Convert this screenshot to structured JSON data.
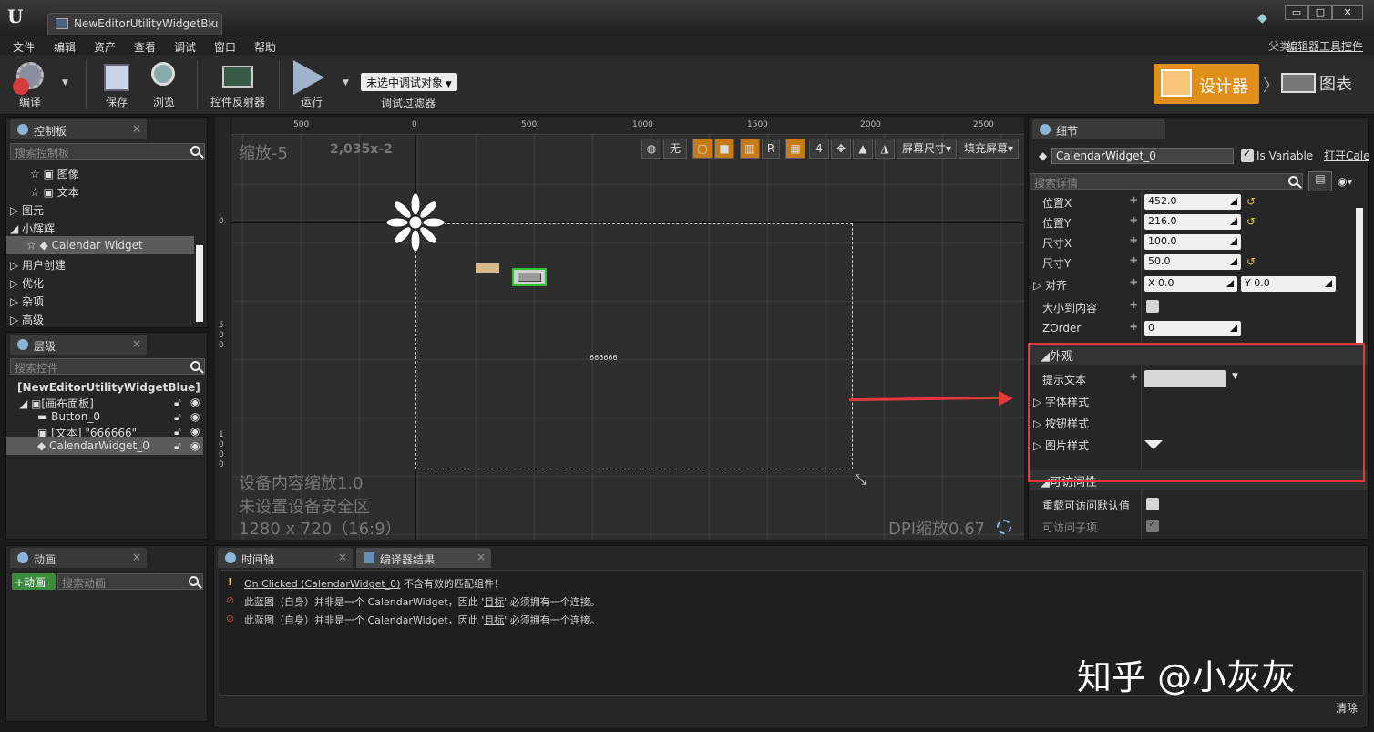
{
  "window": {
    "tab_title": "NewEditorUtilityWidgetBlu",
    "tab_close": "×",
    "min": "▭",
    "max": "□",
    "close": "✕"
  },
  "menu": [
    "文件",
    "编辑",
    "资产",
    "查看",
    "调试",
    "窗口",
    "帮助"
  ],
  "parent": {
    "label": "父类：",
    "value": "编辑器工具控件"
  },
  "toolbar": {
    "compile": "编译",
    "save": "保存",
    "browse": "浏览",
    "widget_reflector": "控件反射器",
    "run": "运行",
    "debug_dropdown": "未选中调试对象",
    "debug_filter": "调试过滤器",
    "designer": "设计器",
    "graph": "图表"
  },
  "palette": {
    "tab": "控制板",
    "search": "搜索控制板",
    "items": [
      {
        "label": "图像",
        "indent": 2
      },
      {
        "label": "文本",
        "indent": 2
      },
      {
        "label": "图元",
        "indent": 0
      },
      {
        "label": "小辉辉",
        "indent": 0
      },
      {
        "label": "Calendar Widget",
        "indent": 2
      },
      {
        "label": "用户创建",
        "indent": 0
      },
      {
        "label": "优化",
        "indent": 0
      },
      {
        "label": "杂项",
        "indent": 0
      },
      {
        "label": "高级",
        "indent": 0
      }
    ]
  },
  "hierarchy": {
    "tab": "层级",
    "search": "搜索控件",
    "root": "[NewEditorUtilityWidgetBlue]",
    "items": [
      "[画布面板]",
      "Button_0",
      "[文本] \"666666\"",
      "CalendarWidget_0"
    ]
  },
  "designer": {
    "zoom": "缩放-5",
    "coords": "2,035x-2",
    "device_scale": "设备内容缩放1.0",
    "safe_zone": "未设置设备安全区",
    "resolution": "1280 x 720（16:9）",
    "dpi": "DPI缩放0.67",
    "canvas_text": "666666",
    "ruler_top": [
      "500",
      "0",
      "500",
      "1000",
      "1500",
      "2000",
      "2500"
    ],
    "ruler_left": [
      "0",
      "5 0 0",
      "1 0 0 0"
    ],
    "tools": {
      "none": "无",
      "r": "R",
      "four": "4",
      "screen_size": "屏幕尺寸▾",
      "fill_screen": "填充屏幕▾"
    }
  },
  "details": {
    "tab": "细节",
    "name": "CalendarWidget_0",
    "is_variable": "Is Variable",
    "open": "打开Cale",
    "search": "搜索详情",
    "props": [
      {
        "label": "位置X",
        "value": "452.0"
      },
      {
        "label": "位置Y",
        "value": "216.0"
      },
      {
        "label": "尺寸X",
        "value": "100.0"
      },
      {
        "label": "尺寸Y",
        "value": "50.0"
      }
    ],
    "align": {
      "label": "对齐",
      "x": "X  0.0",
      "y": "Y  0.0"
    },
    "size_to_content": "大小到内容",
    "zorder": {
      "label": "ZOrder",
      "value": "0"
    },
    "appearance": "外观",
    "tooltip": "提示文本",
    "font_style": "字体样式",
    "button_style": "按钮样式",
    "image_style": "图片样式",
    "accessibility": "可访问性",
    "override_accessible": "重载可访问默认值",
    "accessible_children": "可访问子项"
  },
  "animation": {
    "tab": "动画",
    "add": "+动画",
    "search": "搜索动画"
  },
  "bottom": {
    "timeline_tab": "时间轴",
    "compiler_tab": "编译器结果",
    "messages": [
      {
        "icon": "warning",
        "link": "On Clicked (CalendarWidget_0)",
        "text": " 不含有效的匹配组件！"
      },
      {
        "icon": "error",
        "text": "此蓝图（自身）并非是一个 CalendarWidget，因此 '",
        "link": "目标",
        "tail": "' 必须拥有一个连接。"
      },
      {
        "icon": "error",
        "text": "此蓝图（自身）并非是一个 CalendarWidget，因此 '",
        "link": "目标",
        "tail": "' 必须拥有一个连接。"
      }
    ],
    "clear": "清除",
    "watermark": "知乎 @小灰灰"
  },
  "colors": {
    "accent": "#e18f1b",
    "highlight_box": "#e03a3a",
    "selection": "#5b5b5b"
  }
}
